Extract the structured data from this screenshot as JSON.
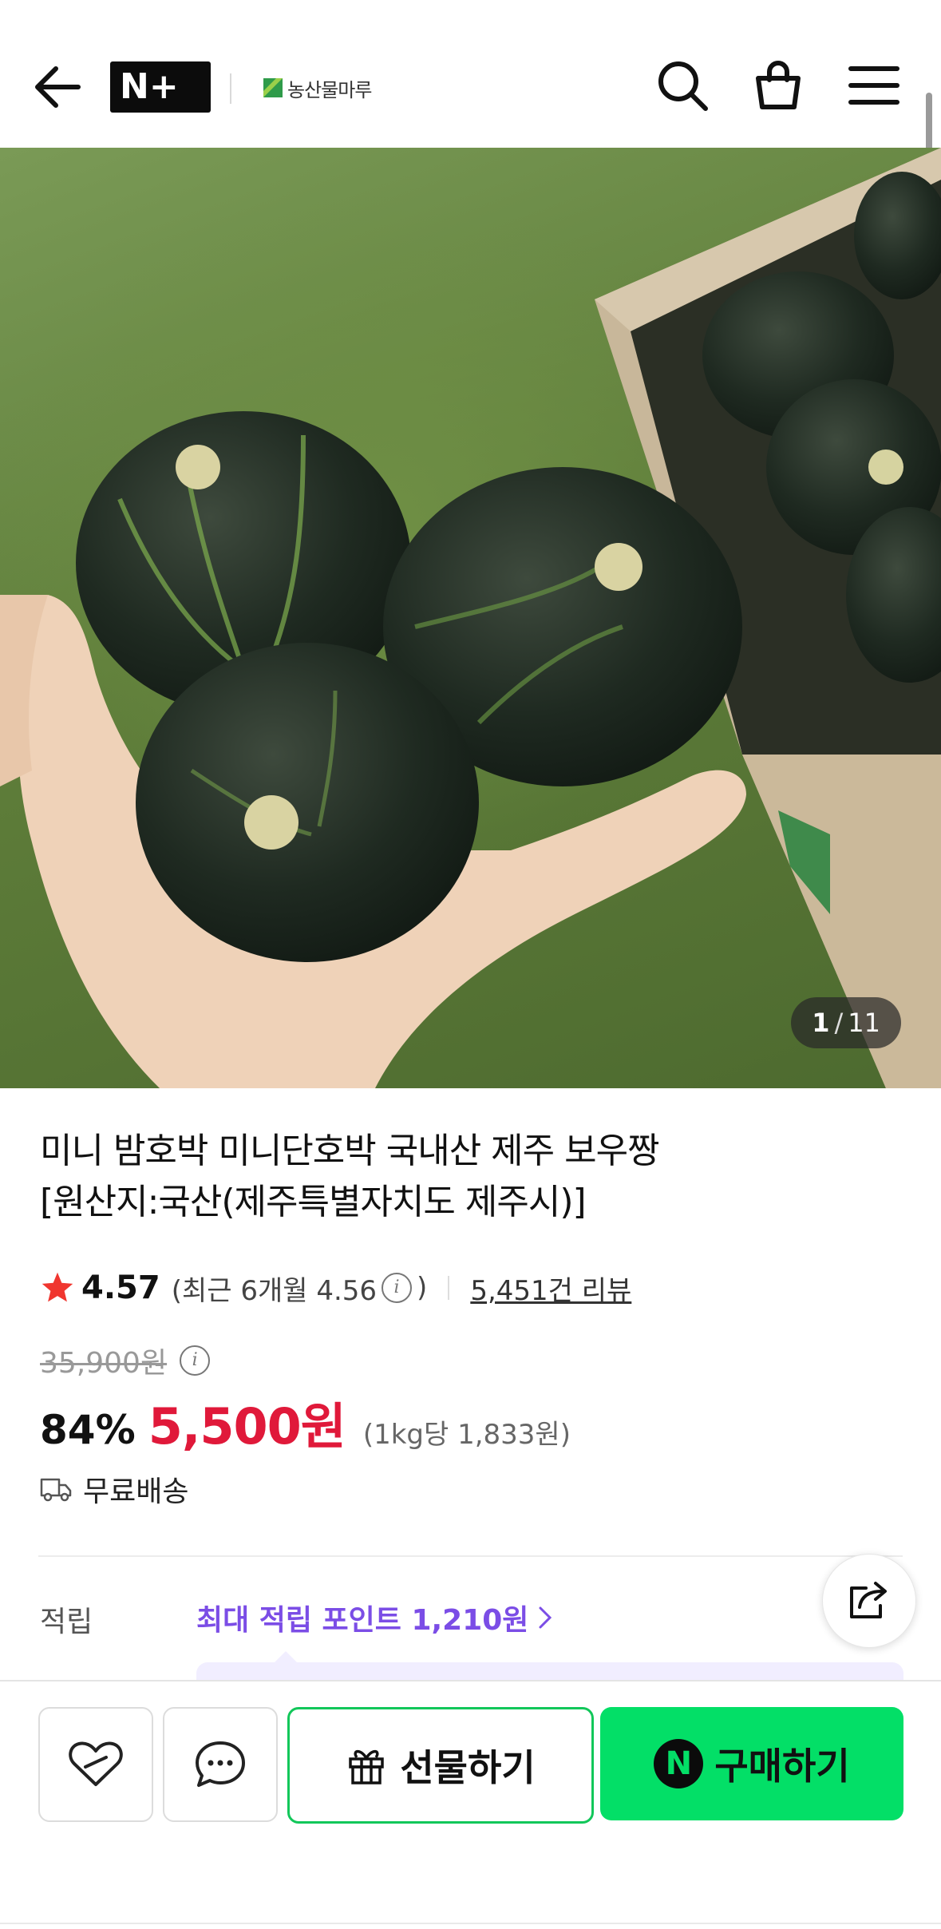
{
  "header": {
    "logo_text": "N+",
    "brand_name": "농산물마루"
  },
  "gallery": {
    "current": "1",
    "separator": "/",
    "total": "11"
  },
  "product": {
    "title_line1": "미니 밤호박 미니단호박 국내산 제주 보우짱",
    "title_line2": "[원산지:국산(제주특별자치도 제주시)]",
    "rating": "4.57",
    "recent_rating": "(최근 6개월 4.56",
    "recent_rating_close": ")",
    "review_count": "5,451건 리뷰",
    "original_price": "35,900원",
    "discount": "84%",
    "price": "5,500원",
    "unit_price": "(1kg당 1,833원)",
    "shipping": "무료배송"
  },
  "points": {
    "label": "적립",
    "value": "최대 적립 포인트 1,210원"
  },
  "bottom_bar": {
    "gift_label": "선물하기",
    "buy_label": "구매하기",
    "npay_mark": "N"
  },
  "colors": {
    "price_red": "#e0193a",
    "points_purple": "#7b4de6",
    "buy_green": "#03df67",
    "gift_border_green": "#12c75a",
    "star_red": "#f0362f"
  }
}
